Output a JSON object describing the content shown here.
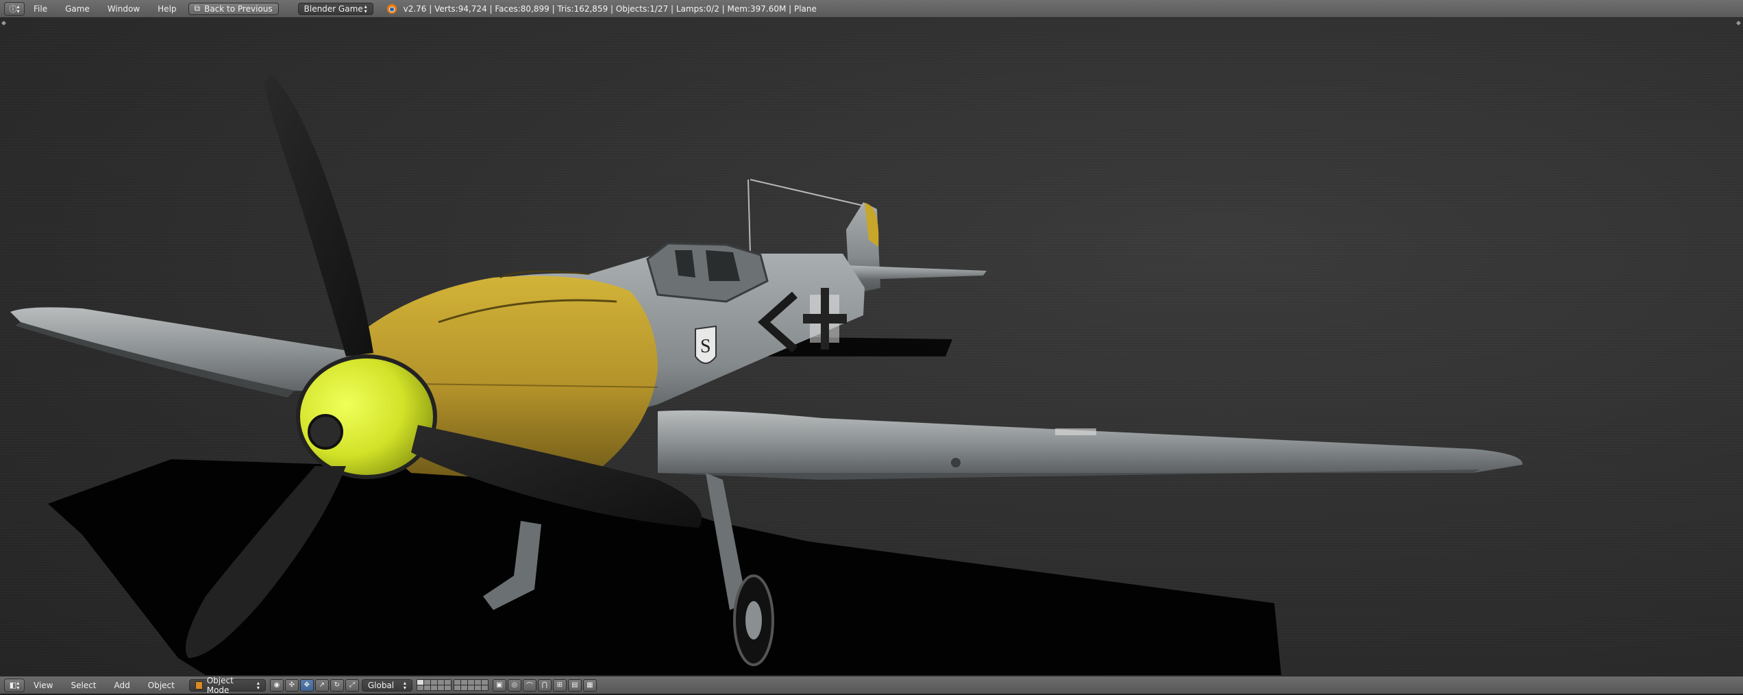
{
  "header": {
    "editor_type_icon": "info-editor-icon",
    "menu": [
      "File",
      "Game",
      "Window",
      "Help"
    ],
    "back_button": "Back to Previous",
    "render_engine": "Blender Game",
    "stats": "v2.76 | Verts:94,724 | Faces:80,899 | Tris:162,859 | Objects:1/27 | Lamps:0/2 | Mem:397.60M | Plane"
  },
  "viewport": {
    "scene": "Bf 109 fighter plane model",
    "colors": {
      "nose_yellow": "#c8a62a",
      "spinner": "#d9ec2c",
      "fuselage": "#8c9296",
      "propeller": "#1c1c1c",
      "shadow": "#000000"
    }
  },
  "bottom_bar": {
    "editor_type_icon": "3d-view-editor-icon",
    "menu": [
      "View",
      "Select",
      "Add",
      "Object"
    ],
    "mode": "Object Mode",
    "orientation": "Global"
  }
}
